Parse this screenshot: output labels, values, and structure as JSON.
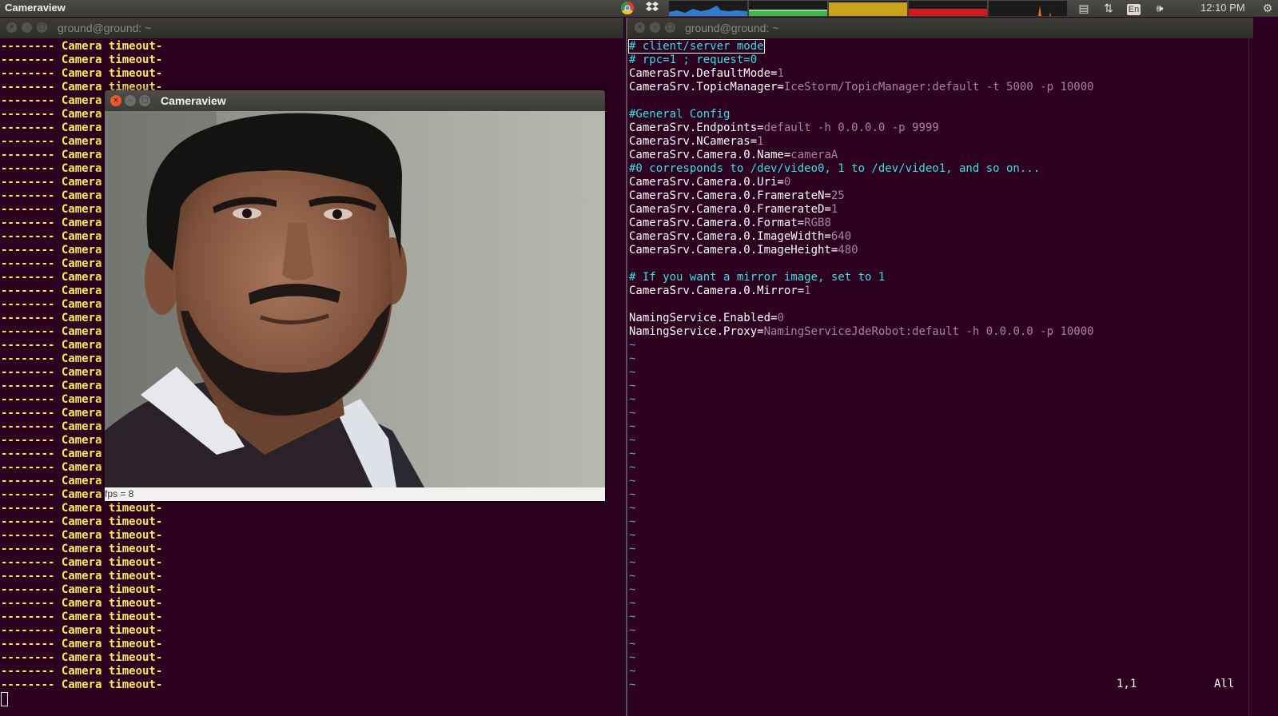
{
  "top_panel": {
    "app_title": "Cameraview",
    "clock": "12:10 PM",
    "keyboard_layout": "En",
    "icons": [
      "chrome-icon",
      "dropbox-icon",
      "network-graph",
      "memory-graph",
      "cpu-graph",
      "disk-graph",
      "load-graph",
      "indicator-messages-icon",
      "network-updown-icon",
      "keyboard-icon",
      "volume-icon",
      "gear-icon"
    ]
  },
  "left_terminal": {
    "title": "ground@ground: ~",
    "lines": [
      "-------- Camera timeout-",
      "-------- Camera timeout-",
      "-------- Camera timeout-",
      "-------- Camera timeout-",
      "-------- Camera timeout-",
      "-------- Camera timeout-",
      "-------- Camera timeout-",
      "-------- Camera timeout-",
      "-------- Camera timeout-",
      "-------- Camera timeout-",
      "-------- Camera timeout-",
      "-------- Camera timeout-",
      "-------- Camera timeout-",
      "-------- Camera timeout-",
      "-------- Camera timeout-",
      "-------- Camera timeout-",
      "-------- Camera timeout-",
      "-------- Camera timeout-",
      "-------- Camera timeout-",
      "-------- Camera timeout-",
      "-------- Camera timeout-",
      "-------- Camera timeout-",
      "-------- Camera timeout-",
      "-------- Camera timeout-",
      "-------- Camera timeout-",
      "-------- Camera timeout-",
      "-------- Camera timeout-",
      "-------- Camera timeout-",
      "-------- Camera timeout-",
      "-------- Camera timeout-",
      "-------- Camera timeout-",
      "-------- Camera timeout-",
      "-------- Camera timeout-",
      "-------- Camera timeout-",
      "-------- Camera timeout-",
      "-------- Camera timeout-",
      "-------- Camera timeout-",
      "-------- Camera timeout-",
      "-------- Camera timeout-",
      "-------- Camera timeout-",
      "-------- Camera timeout-",
      "-------- Camera timeout-",
      "-------- Camera timeout-",
      "-------- Camera timeout-",
      "-------- Camera timeout-",
      "-------- Camera timeout-",
      "-------- Camera timeout-",
      "-------- Camera timeout-"
    ]
  },
  "right_terminal": {
    "title": "ground@ground: ~",
    "lines": [
      {
        "parts": [
          {
            "t": "# client/server mode",
            "c": "c-comment"
          }
        ]
      },
      {
        "parts": [
          {
            "t": "# rpc=1 ; request=0",
            "c": "c-comment"
          }
        ]
      },
      {
        "parts": [
          {
            "t": "CameraSrv.DefaultMode=",
            "c": ""
          },
          {
            "t": "1",
            "c": "c-val"
          }
        ]
      },
      {
        "parts": [
          {
            "t": "CameraSrv.TopicManager=",
            "c": ""
          },
          {
            "t": "IceStorm/TopicManager:default -t 5000 -p 10000",
            "c": "c-val"
          }
        ]
      },
      {
        "parts": [
          {
            "t": "",
            "c": ""
          }
        ]
      },
      {
        "parts": [
          {
            "t": "#General Config",
            "c": "c-comment"
          }
        ]
      },
      {
        "parts": [
          {
            "t": "CameraSrv.Endpoints=",
            "c": ""
          },
          {
            "t": "default -h 0.0.0.0 -p 9999",
            "c": "c-val"
          }
        ]
      },
      {
        "parts": [
          {
            "t": "CameraSrv.NCameras=",
            "c": ""
          },
          {
            "t": "1",
            "c": "c-val"
          }
        ]
      },
      {
        "parts": [
          {
            "t": "CameraSrv.Camera.0.Name=",
            "c": ""
          },
          {
            "t": "cameraA",
            "c": "c-val"
          }
        ]
      },
      {
        "parts": [
          {
            "t": "#0 corresponds to /dev/video0, 1 to /dev/video1, and so on...",
            "c": "c-comment"
          }
        ]
      },
      {
        "parts": [
          {
            "t": "CameraSrv.Camera.0.Uri=",
            "c": ""
          },
          {
            "t": "0",
            "c": "c-val"
          }
        ]
      },
      {
        "parts": [
          {
            "t": "CameraSrv.Camera.0.FramerateN=",
            "c": ""
          },
          {
            "t": "25",
            "c": "c-val"
          }
        ]
      },
      {
        "parts": [
          {
            "t": "CameraSrv.Camera.0.FramerateD=",
            "c": ""
          },
          {
            "t": "1",
            "c": "c-val"
          }
        ]
      },
      {
        "parts": [
          {
            "t": "CameraSrv.Camera.0.Format=",
            "c": ""
          },
          {
            "t": "RGB8",
            "c": "c-val"
          }
        ]
      },
      {
        "parts": [
          {
            "t": "CameraSrv.Camera.0.ImageWidth=",
            "c": ""
          },
          {
            "t": "640",
            "c": "c-val"
          }
        ]
      },
      {
        "parts": [
          {
            "t": "CameraSrv.Camera.0.ImageHeight=",
            "c": ""
          },
          {
            "t": "480",
            "c": "c-val"
          }
        ]
      },
      {
        "parts": [
          {
            "t": "",
            "c": ""
          }
        ]
      },
      {
        "parts": [
          {
            "t": "# If you want a mirror image, set to 1",
            "c": "c-comment"
          }
        ]
      },
      {
        "parts": [
          {
            "t": "CameraSrv.Camera.0.Mirror=",
            "c": ""
          },
          {
            "t": "1",
            "c": "c-val"
          }
        ]
      },
      {
        "parts": [
          {
            "t": "",
            "c": ""
          }
        ]
      },
      {
        "parts": [
          {
            "t": "NamingService.Enabled=",
            "c": ""
          },
          {
            "t": "0",
            "c": "c-val"
          }
        ]
      },
      {
        "parts": [
          {
            "t": "NamingService.Proxy=",
            "c": ""
          },
          {
            "t": "NamingServiceJdeRobot:default -h 0.0.0.0 -p 10000",
            "c": "c-val"
          }
        ]
      }
    ],
    "tilde_rows": 26,
    "status_position": "1,1",
    "status_scope": "All"
  },
  "camera_window": {
    "title": "Cameraview",
    "status": "fps = 8"
  }
}
